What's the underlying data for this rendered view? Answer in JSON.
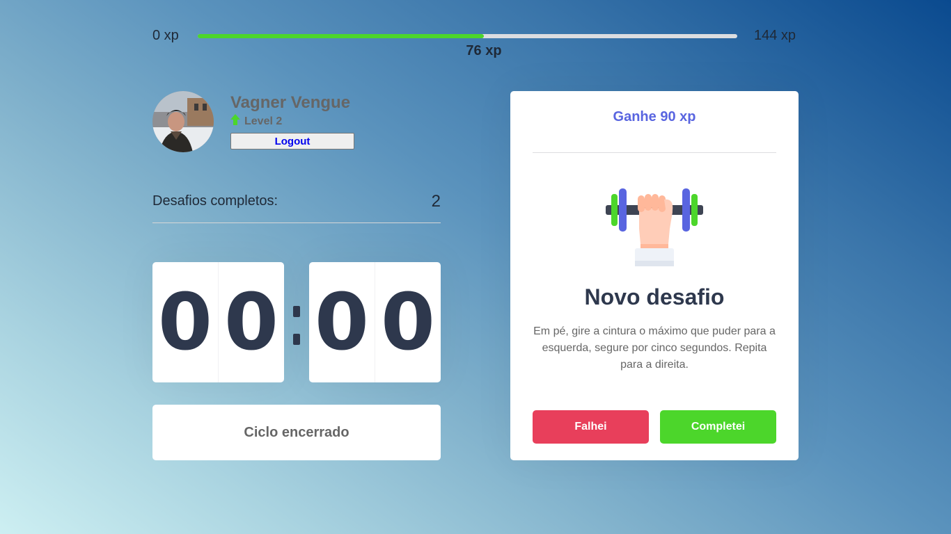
{
  "experience": {
    "min_label": "0 xp",
    "max_label": "144 xp",
    "current_label": "76 xp",
    "progress_fraction": 0.53,
    "bar_color": "#4cd62b"
  },
  "profile": {
    "name": "Vagner Vengue",
    "level_label": "Level 2",
    "logout_label": "Logout",
    "level_icon": "arrow-up-icon"
  },
  "stats": {
    "completed_label": "Desafios completos:",
    "completed_count": "2"
  },
  "countdown": {
    "minute_left": "0",
    "minute_right": "0",
    "second_left": "0",
    "second_right": "0"
  },
  "cycle": {
    "button_label": "Ciclo encerrado"
  },
  "challenge": {
    "reward_label": "Ganhe 90 xp",
    "icon": "dumbbell-icon",
    "title": "Novo desafio",
    "description": "Em pé, gire a cintura o máximo que puder para a esquerda, segure por cinco segundos. Repita para a direita.",
    "fail_label": "Falhei",
    "success_label": "Completei",
    "fail_color": "#e83f5b",
    "success_color": "#4cd62b"
  }
}
